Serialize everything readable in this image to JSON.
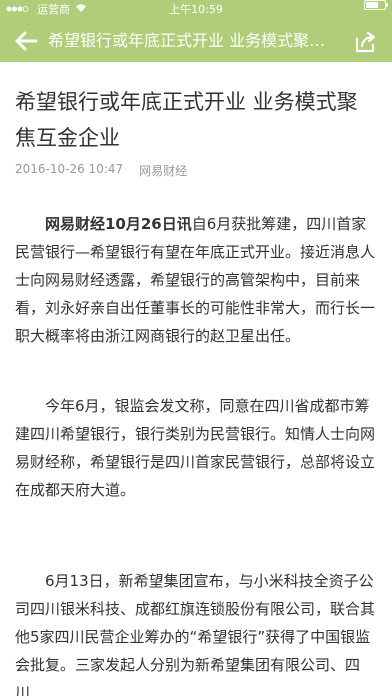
{
  "status_bar": {
    "carrier": "运营商",
    "time": "上午10:59"
  },
  "nav": {
    "title": "希望银行或年底正式开业 业务模式聚焦互金企业"
  },
  "article": {
    "title": "希望银行或年底正式开业 业务模式聚焦互金企业",
    "date": "2016-10-26 10:47",
    "source": "网易财经",
    "p1_lead": "网易财经10月26日讯",
    "p1_rest": "自6月获批筹建，四川首家民营银行—希望银行有望在年底正式开业。接近消息人士向网易财经透露，希望银行的高管架构中，目前来看，刘永好亲自出任董事长的可能性非常大，而行长一职大概率将由浙江网商银行的赵卫星出任。",
    "p2": "今年6月，银监会发文称，同意在四川省成都市筹建四川希望银行，银行类别为民营银行。知情人士向网易财经称，希望银行是四川首家民营银行，总部将设立在成都天府大道。",
    "p3": "6月13日，新希望集团宣布，与小米科技全资子公司四川银米科技、成都红旗连锁股份有限公司，联合其他5家四川民营企业筹办的“希望银行”获得了中国银监会批复。三家发起人分别为新希望集团有限公司、四川..."
  },
  "colors": {
    "brand_green": "#b0cd7a",
    "text": "#333333",
    "meta": "#999999"
  },
  "icons": {
    "back": "back-arrow-icon",
    "share": "share-icon",
    "wifi": "wifi-icon",
    "signal": "signal-icon",
    "battery": "battery-icon"
  }
}
